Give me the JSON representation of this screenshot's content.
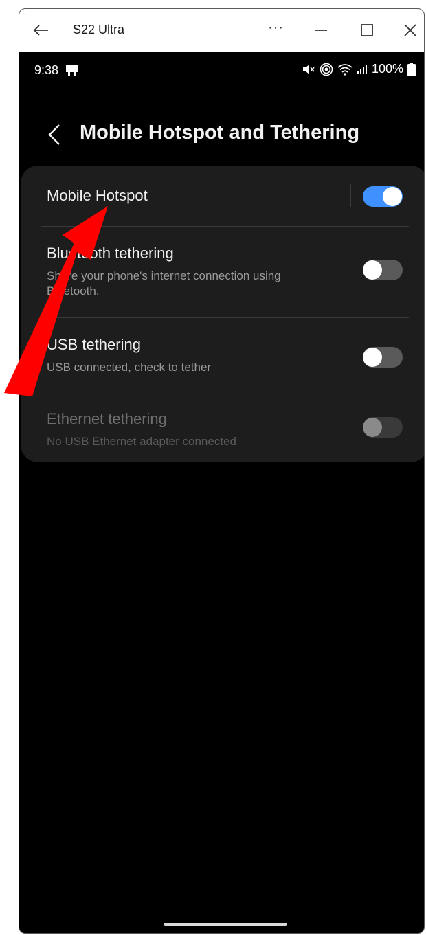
{
  "window": {
    "title": "S22 Ultra",
    "more_label": "···"
  },
  "statusbar": {
    "time": "9:38",
    "battery": "100%"
  },
  "header": {
    "title": "Mobile Hotspot and Tethering"
  },
  "settings": [
    {
      "title": "Mobile Hotspot",
      "subtitle": "",
      "state": "on"
    },
    {
      "title": "Bluetooth tethering",
      "subtitle": "Share your phone's internet connection using Bluetooth.",
      "state": "off"
    },
    {
      "title": "USB tethering",
      "subtitle": "USB connected, check to tether",
      "state": "off"
    },
    {
      "title": "Ethernet tethering",
      "subtitle": "No USB Ethernet adapter connected",
      "state": "disabled"
    }
  ],
  "colors": {
    "accent": "#3e91ff",
    "annotation_arrow": "#ff0000",
    "card_background": "#1d1d1d"
  },
  "icons": [
    "back-arrow-icon",
    "more-icon",
    "minimize-icon",
    "maximize-icon",
    "close-icon",
    "cast-icon",
    "mute-icon",
    "hotspot-icon",
    "wifi-icon",
    "signal-icon",
    "battery-icon",
    "chevron-left-icon"
  ]
}
